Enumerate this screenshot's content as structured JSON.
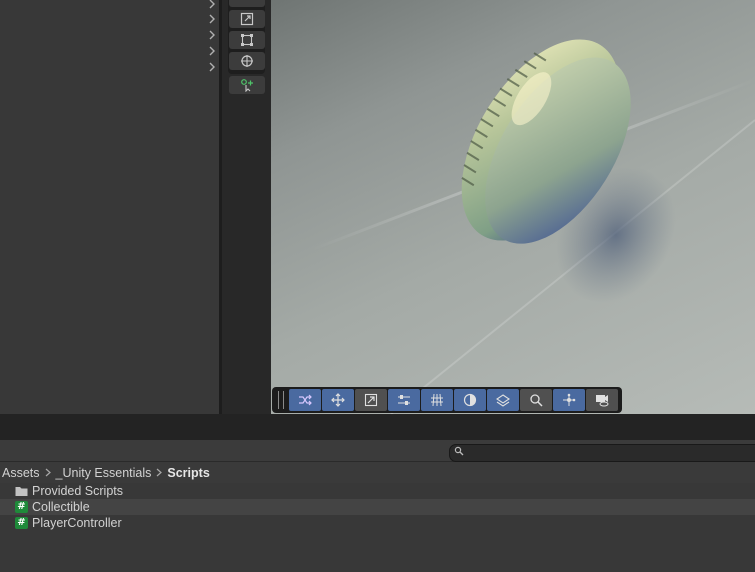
{
  "project": {
    "breadcrumb": [
      "Assets",
      "_Unity Essentials",
      "Scripts"
    ],
    "search": {
      "placeholder": "",
      "value": ""
    },
    "items": [
      {
        "label": "Provided Scripts",
        "icon": "folder-icon"
      },
      {
        "label": "Collectible",
        "icon": "csharp-script-icon"
      },
      {
        "label": "PlayerController",
        "icon": "csharp-script-icon"
      }
    ]
  },
  "script_icon_glyph": "#",
  "colors": {
    "overlay_button_active": "#4a6aa0",
    "script_icon": "#1f8a3a",
    "panel_bg": "#383838"
  }
}
